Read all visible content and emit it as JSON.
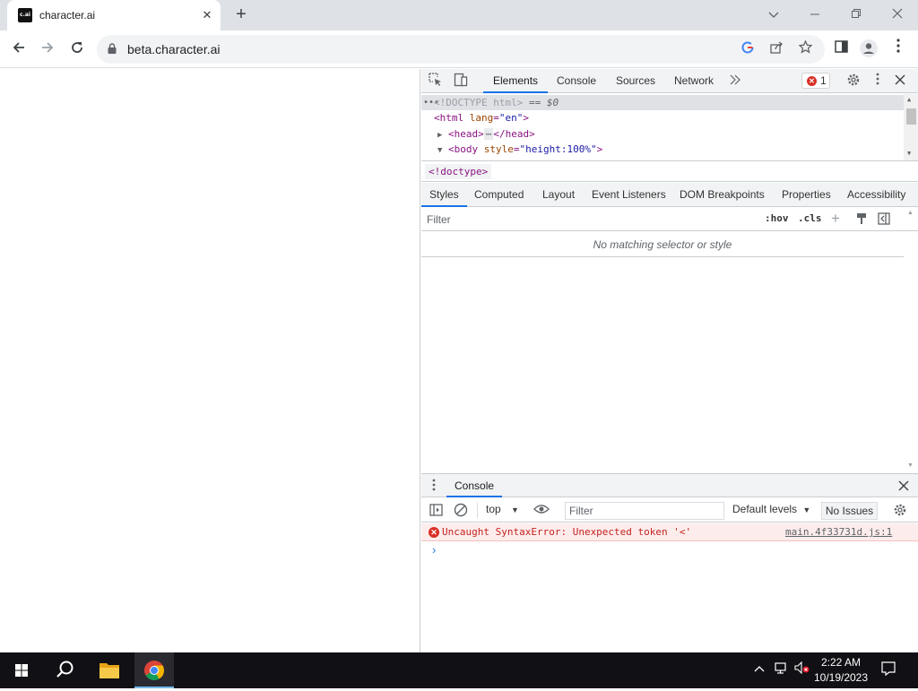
{
  "browser": {
    "tab_title": "character.ai",
    "tab_favicon_text": "c.ai",
    "url": "beta.character.ai"
  },
  "devtools": {
    "tabs": [
      {
        "label": "Elements",
        "active": true
      },
      {
        "label": "Console"
      },
      {
        "label": "Sources"
      },
      {
        "label": "Network"
      }
    ],
    "error_count": "1",
    "tree": {
      "doctype_line": "<!DOCTYPE html>",
      "doctype_suffix": "== $0",
      "html_open": "<html",
      "html_attr": "lang",
      "html_val": "\"en\"",
      "html_close": ">",
      "head_open": "<head>",
      "head_ellipsis": "⋯",
      "head_close": "</head>",
      "body_open": "<body",
      "body_attr": "style",
      "body_val": "\"height:100%\"",
      "body_close": ">"
    },
    "breadcrumb": "<!doctype>",
    "subtabs": [
      "Styles",
      "Computed",
      "Layout",
      "Event Listeners",
      "DOM Breakpoints",
      "Properties",
      "Accessibility"
    ],
    "styles_filter_placeholder": "Filter",
    "hov": ":hov",
    "cls": ".cls",
    "no_match": "No matching selector or style",
    "drawer_tab": "Console",
    "console": {
      "context": "top",
      "filter_placeholder": "Filter",
      "levels": "Default levels",
      "issues": "No Issues",
      "error_message": "Uncaught SyntaxError: Unexpected token '<'",
      "error_source": "main.4f33731d.js:1"
    }
  },
  "taskbar": {
    "time": "2:22 AM",
    "date": "10/19/2023"
  },
  "colors": {
    "accent": "#1a73e8",
    "error": "#d93025",
    "tag": "#881280"
  }
}
